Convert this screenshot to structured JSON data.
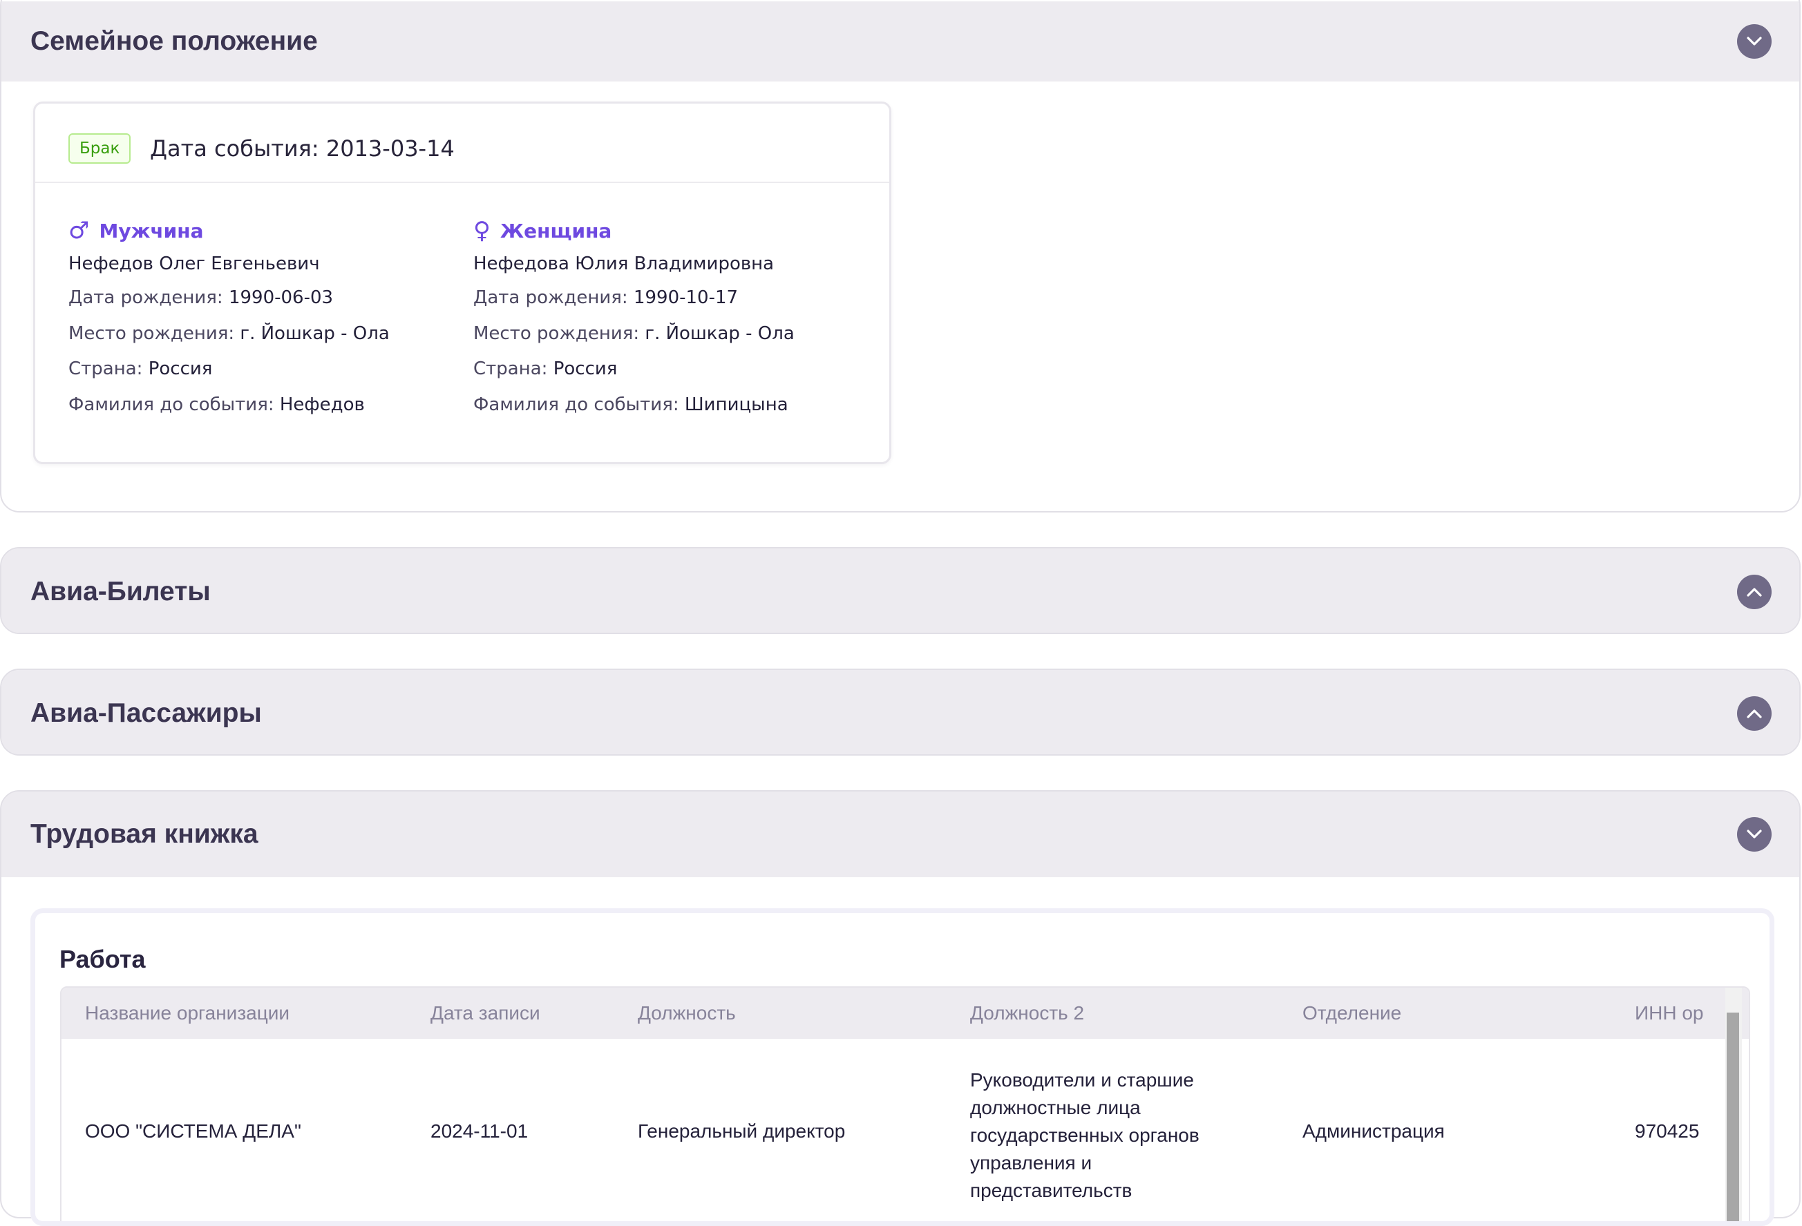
{
  "sections": {
    "family": {
      "title": "Семейное положение",
      "toggle_icon": "chevron-down-icon"
    },
    "tickets": {
      "title": "Авиа-Билеты",
      "toggle_icon": "chevron-up-icon"
    },
    "passengers": {
      "title": "Авиа-Пассажиры",
      "toggle_icon": "chevron-up-icon"
    },
    "workbook": {
      "title": "Трудовая книжка",
      "toggle_icon": "chevron-down-icon"
    }
  },
  "marriage": {
    "tag": "Брак",
    "event_date": "Дата события: 2013-03-14",
    "male": {
      "role": "Мужчина",
      "icon": "male-icon",
      "name": "Нефедов Олег Евгеньевич",
      "birth_label": "Дата рождения:",
      "birth_value": "1990-06-03",
      "place_label": "Место рождения:",
      "place_value": "г. Йошкар - Ола",
      "country_label": "Страна:",
      "country_value": "Россия",
      "surname_label": "Фамилия до события:",
      "surname_value": "Нефедов"
    },
    "female": {
      "role": "Женщина",
      "icon": "female-icon",
      "name": "Нефедова Юлия Владимировна",
      "birth_label": "Дата рождения:",
      "birth_value": "1990-10-17",
      "place_label": "Место рождения:",
      "place_value": "г. Йошкар - Ола",
      "country_label": "Страна:",
      "country_value": "Россия",
      "surname_label": "Фамилия до события:",
      "surname_value": "Шипицына"
    }
  },
  "work": {
    "title": "Работа",
    "columns": [
      "Название организации",
      "Дата записи",
      "Должность",
      "Должность 2",
      "Отделение",
      "ИНН ор"
    ],
    "rows": [
      {
        "org": "ООО \"СИСТЕМА ДЕЛА\"",
        "date": "2024-11-01",
        "position": "Генеральный директор",
        "position2": "Руководители и старшие должностные лица государственных органов управления и представительств",
        "department": "Администрация",
        "inn": "970425"
      }
    ]
  },
  "colors": {
    "accent": "#6e49e0",
    "header_bg": "#edebf0",
    "toggle_bg": "#706a87",
    "tag_green": "#389e0d"
  }
}
